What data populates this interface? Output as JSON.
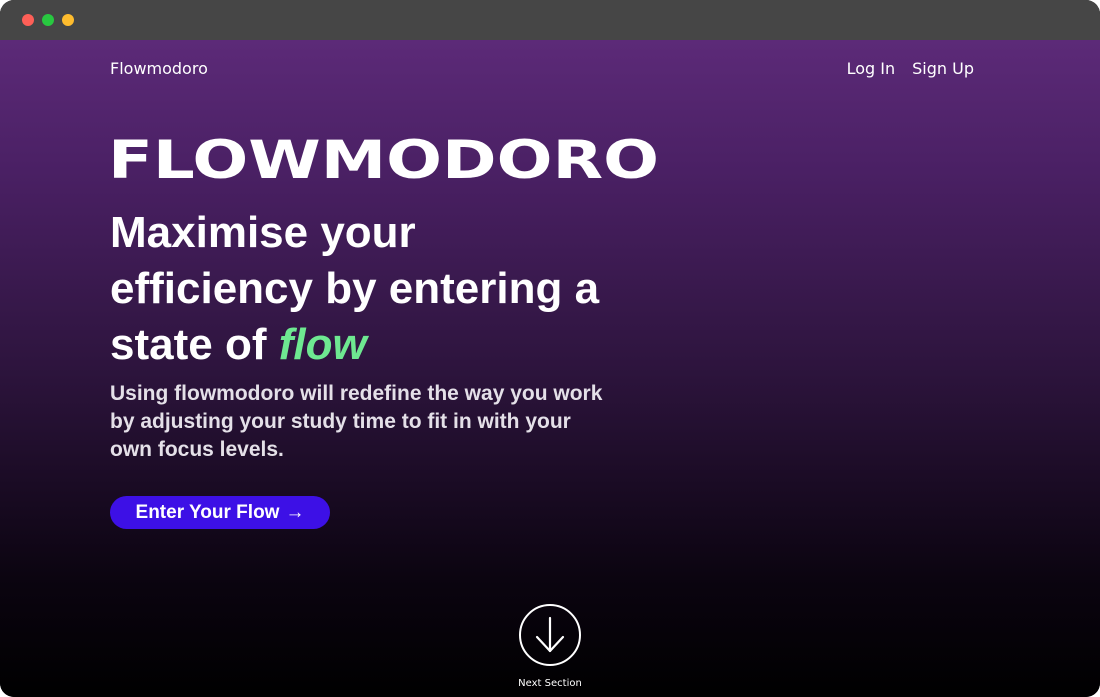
{
  "window": {
    "controls": [
      "close",
      "minimize",
      "zoom"
    ]
  },
  "nav": {
    "brand": "Flowmodoro",
    "login": "Log In",
    "signup": "Sign Up"
  },
  "hero": {
    "wordmark": "FLOWMODORO",
    "headline_main": "Maximise your efficiency by entering a state of ",
    "headline_highlight": "flow",
    "subtext": "Using flowmodoro will redefine the way you work by adjusting your study time to fit in with your own focus levels.",
    "cta_label": "Enter Your Flow",
    "cta_arrow": "→"
  },
  "next_section": {
    "label": "Next Section",
    "icon": "arrow-down-icon"
  },
  "colors": {
    "accent": "#3d10e6",
    "highlight": "#6ee891",
    "gradient_top": "#5c2a78",
    "gradient_bottom": "#000000"
  }
}
